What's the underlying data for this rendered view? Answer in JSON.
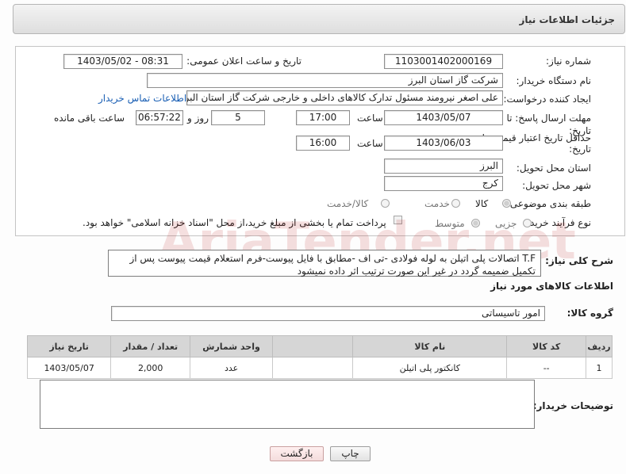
{
  "title": "جزئیات اطلاعات نیاز",
  "form": {
    "need_number_label": "شماره نیاز:",
    "need_number": "1103001402000169",
    "announce_label": "تاریخ و ساعت اعلان عمومی:",
    "announce_value": "1403/05/02 - 08:31",
    "buyer_org_label": "نام دستگاه خریدار:",
    "buyer_org": "شرکت گاز استان البرز",
    "creator_label": "ایجاد کننده درخواست:",
    "creator": "علی اصغر نیرومند مسئول تدارک کالاهای داخلی و خارجی شرکت گاز استان البرز",
    "contact_link": "اطلاعات تماس خریدار",
    "deadline_label_1": "مهلت ارسال پاسخ: تا",
    "deadline_label_2": "تاریخ:",
    "deadline_date": "1403/05/07",
    "time_label": "ساعت",
    "deadline_time": "17:00",
    "days": "5",
    "days_label": "روز و",
    "remaining_time": "06:57:22",
    "remaining_label": "ساعت باقی مانده",
    "validity_label_1": "حداقل تاریخ اعتبار قیمت: تا",
    "validity_label_2": "تاریخ:",
    "validity_date": "1403/06/03",
    "validity_time": "16:00",
    "province_label": "استان محل تحویل:",
    "province": "البرز",
    "city_label": "شهر محل تحویل:",
    "city": "کرج",
    "category_label": "طبقه بندی موضوعی:",
    "category_options": [
      "کالا",
      "خدمت",
      "کالا/خدمت"
    ],
    "category_selected": "کالا",
    "process_label": "نوع فرآیند خرید :",
    "process_options": [
      "جزیی",
      "متوسط"
    ],
    "process_selected": "متوسط",
    "payment_note": "پرداخت تمام یا بخشی از مبلغ خرید،از محل \"اسناد خزانه اسلامی\" خواهد بود."
  },
  "summary": {
    "label": "شرح کلی نیاز:",
    "text": "T.F اتصالات پلی اتیلن به لوله فولادی -تی اف -مطابق با فایل پیوست-فرم استعلام قیمت پیوست پس از تکمیل ضمیمه گردد در غیر این صورت ترتیب اثر داده نمیشود"
  },
  "goods": {
    "section_title": "اطلاعات کالاهای مورد نیاز",
    "group_label": "گروه کالا:",
    "group_value": "امور تاسیساتی",
    "headers": [
      "ردیف",
      "کد کالا",
      "نام کالا",
      "واحد شمارش",
      "تعداد / مقدار",
      "تاریخ نیاز"
    ],
    "rows": [
      {
        "row": "1",
        "code": "--",
        "name": "کانکتور پلی اتیلن",
        "unit": "عدد",
        "qty": "2,000",
        "date": "1403/05/07"
      }
    ]
  },
  "buyer_notes_label": "توضیحات خریدار:",
  "buttons": {
    "print": "چاپ",
    "back": "بازگشت"
  },
  "watermark": "AriaTender.net"
}
